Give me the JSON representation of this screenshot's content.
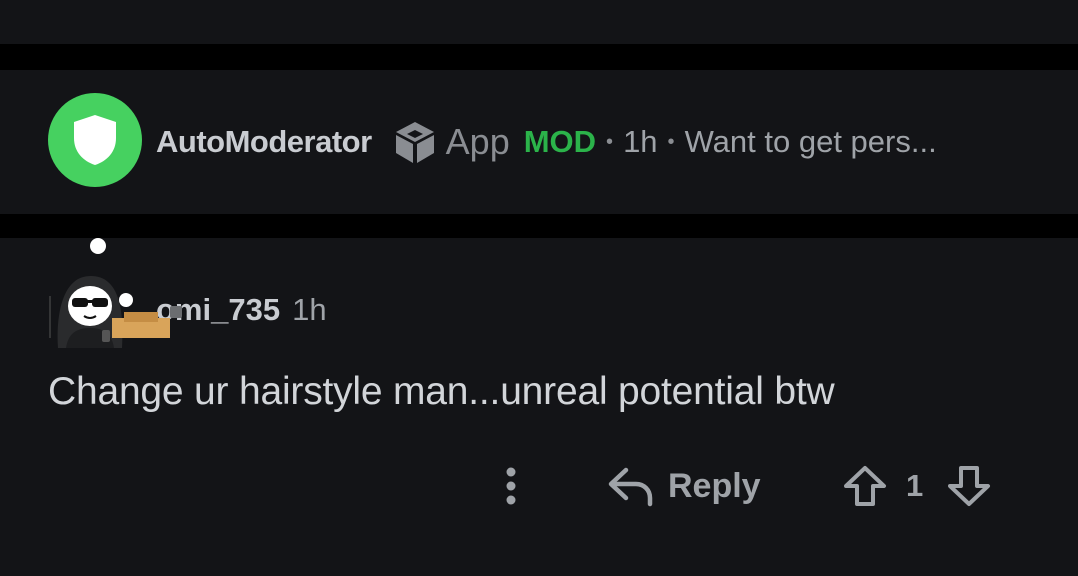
{
  "automod": {
    "name": "AutoModerator",
    "app_label": "App",
    "mod_label": "MOD",
    "separator": "•",
    "time": "1h",
    "snippet": "Want to get pers..."
  },
  "comment": {
    "username": "omi_735",
    "time": "1h",
    "body": "Change ur hairstyle man...unreal potential btw",
    "reply_label": "Reply",
    "vote_count": "1"
  },
  "icons": {
    "automod_avatar": "shield-icon",
    "app": "cube-icon",
    "more": "more-vertical-icon",
    "reply": "reply-arrow-icon",
    "upvote": "upvote-arrow-icon",
    "downvote": "downvote-arrow-icon"
  },
  "colors": {
    "background": "#131417",
    "automod_avatar": "#46d160",
    "mod_green": "#2bb34a",
    "muted_text": "#9fa3a8"
  }
}
